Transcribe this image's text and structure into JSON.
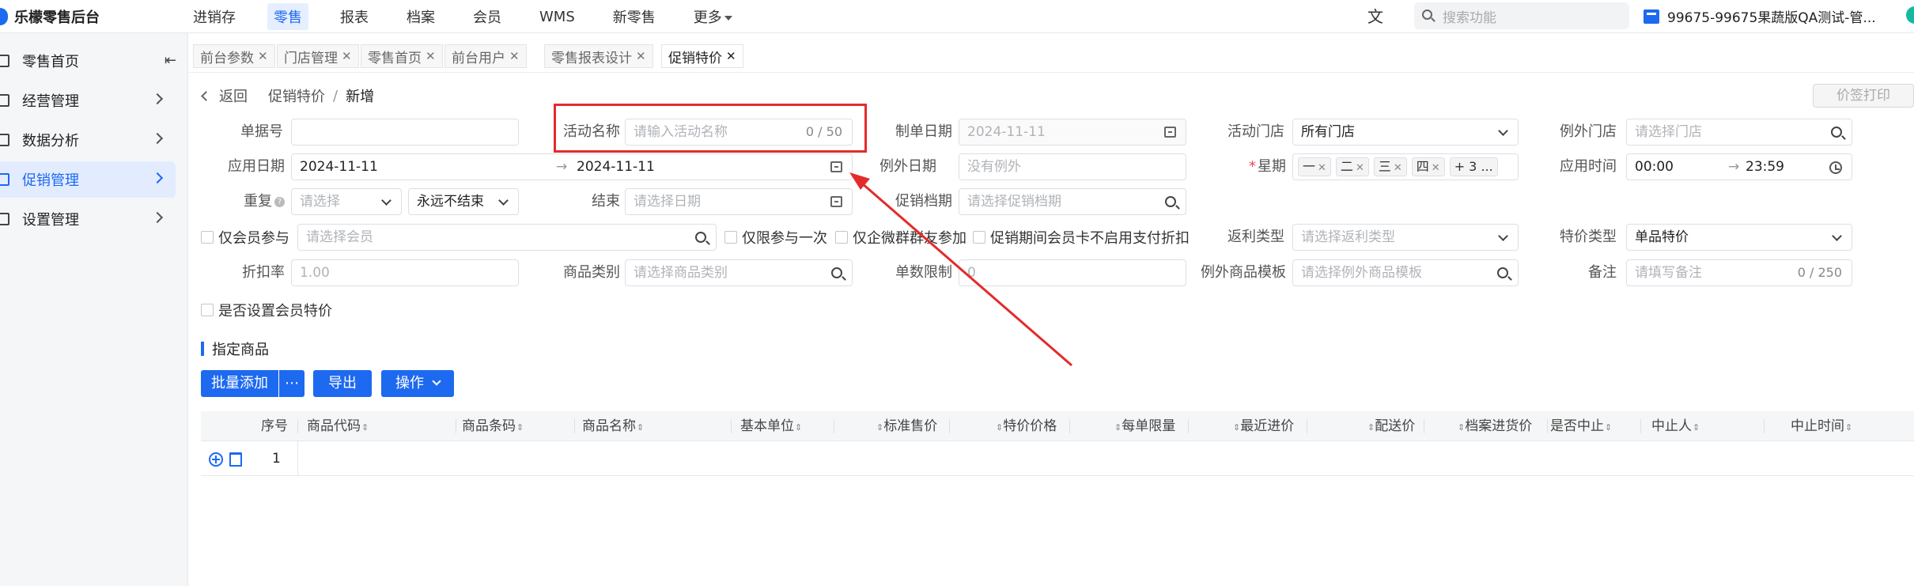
{
  "app": {
    "title": "乐檬零售后台"
  },
  "topnav": {
    "items": [
      "进销存",
      "零售",
      "报表",
      "档案",
      "会员",
      "WMS",
      "新零售",
      "更多"
    ],
    "active_index": 1,
    "search_placeholder": "搜索功能",
    "store_text": "99675-99675果蔬版QA测试-管..."
  },
  "sidebar": {
    "items": [
      {
        "label": "零售首页",
        "has_chevron": false
      },
      {
        "label": "经营管理",
        "has_chevron": true
      },
      {
        "label": "数据分析",
        "has_chevron": true
      },
      {
        "label": "促销管理",
        "has_chevron": true,
        "active": true
      },
      {
        "label": "设置管理",
        "has_chevron": true
      }
    ]
  },
  "tabs": [
    {
      "label": "前台参数"
    },
    {
      "label": "门店管理"
    },
    {
      "label": "零售首页"
    },
    {
      "label": "前台用户"
    },
    {
      "label": "零售报表设计"
    },
    {
      "label": "促销特价",
      "active": true
    }
  ],
  "breadcrumb": {
    "back": "返回",
    "parent": "促销特价",
    "sep": "/",
    "current": "新增"
  },
  "print_button": "价签打印",
  "form": {
    "doc_no_label": "单据号",
    "doc_no_value": "",
    "activity_name_label": "活动名称",
    "activity_name_placeholder": "请输入活动名称",
    "activity_name_count": "0 / 50",
    "make_date_label": "制单日期",
    "make_date_value": "2024-11-11",
    "activity_store_label": "活动门店",
    "activity_store_value": "所有门店",
    "exclude_store_label": "例外门店",
    "exclude_store_placeholder": "请选择门店",
    "apply_date_label": "应用日期",
    "apply_date_start": "2024-11-11",
    "apply_date_end": "2024-11-11",
    "range_sep": "→",
    "exclude_date_label": "例外日期",
    "exclude_date_placeholder": "没有例外",
    "week_label": "星期",
    "week_tags": [
      "一",
      "二",
      "三",
      "四"
    ],
    "week_more": "+ 3 ...",
    "apply_time_label": "应用时间",
    "apply_time_start": "00:00",
    "apply_time_end": "23:59",
    "repeat_label": "重复",
    "repeat_placeholder": "请选择",
    "repeat_end_value": "永远不结束",
    "end_label": "结束",
    "end_placeholder": "请选择日期",
    "promo_file_label": "促销档期",
    "promo_file_placeholder": "请选择促销档期",
    "member_only_label": "仅会员参与",
    "member_placeholder": "请选择会员",
    "once_only_label": "仅限参与一次",
    "wecom_only_label": "仅企微群群友参加",
    "no_discount_label": "促销期间会员卡不启用支付折扣",
    "rebate_type_label": "返利类型",
    "rebate_type_placeholder": "请选择返利类型",
    "special_type_label": "特价类型",
    "special_type_value": "单品特价",
    "discount_label": "折扣率",
    "discount_placeholder": "1.00",
    "category_label": "商品类别",
    "category_placeholder": "请选择商品类别",
    "limit_label": "单数限制",
    "limit_value": "0",
    "exclude_tpl_label": "例外商品模板",
    "exclude_tpl_placeholder": "请选择例外商品模板",
    "remark_label": "备注",
    "remark_placeholder": "请填写备注",
    "remark_count": "0 / 250",
    "member_special_label": "是否设置会员特价"
  },
  "section": {
    "title": "指定商品",
    "batch_add": "批量添加",
    "more": "⋯",
    "export": "导出",
    "operate": "操作"
  },
  "table": {
    "columns": [
      "序号",
      "商品代码",
      "商品条码",
      "商品名称",
      "基本单位",
      "标准售价",
      "特价价格",
      "每单限量",
      "最近进价",
      "配送价",
      "档案进货价",
      "是否中止",
      "中止人",
      "中止时间"
    ],
    "rows": [
      {
        "seq": "1"
      }
    ]
  },
  "colors": {
    "accent": "#1d69f0",
    "highlight": "#e32b2b",
    "required": "#f0494b"
  }
}
